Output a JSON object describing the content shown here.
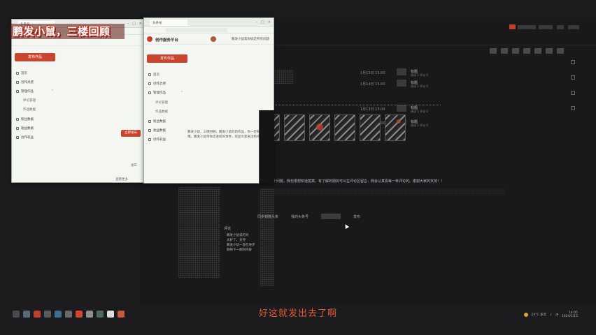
{
  "overlay": {
    "banner_text": "鹏发小鼠，三楼回顾"
  },
  "subtitle": "好这就发出去了啊",
  "background_app": {
    "top_items": [
      "",
      "",
      ""
    ],
    "table_rows": [
      {
        "date": "1月15日 15:00",
        "name": "标题",
        "meta": "阅读 1 评论 0"
      },
      {
        "date": "1月14日 15:00",
        "name": "标题",
        "meta": "阅读 1 评论 0"
      },
      {
        "date": "1月13日 15:00",
        "name": "标题",
        "meta": "阅读 1 评论 0"
      },
      {
        "date": "1月12日 15:00",
        "name": "标题",
        "meta": "阅读 1 评论 0"
      }
    ]
  },
  "window2": {
    "tab_label": "头条号",
    "site_title": "创作服务平台",
    "user_label": "鹏发小鼠帮你搞定所有问题",
    "publish_button": "发布作品",
    "menu": [
      {
        "label": "首页",
        "icon": "home-icon"
      },
      {
        "label": "创作灵感",
        "icon": "bulb-icon"
      },
      {
        "label": "管理作品",
        "icon": "folder-icon"
      },
      {
        "label": "评论管理",
        "icon": "comment-icon",
        "sub": true
      },
      {
        "label": "作品数据",
        "icon": "chart-icon",
        "sub": true
      },
      {
        "label": "粉丝数据",
        "icon": "users-icon"
      },
      {
        "label": "收益数据",
        "icon": "coin-icon"
      },
      {
        "label": "创作权益",
        "icon": "star-icon"
      }
    ],
    "article_text": "鹏发小鼠，三楼回顾，鹏发小鼠的新作品，你一定要去看看哦。鹏发小鼠带你走进新的世界，欢迎大家关注和评论。"
  },
  "window1": {
    "tab_label": "头条号",
    "publish_button": "发布作品",
    "menu": [
      {
        "label": "首页",
        "icon": "home-icon"
      },
      {
        "label": "创作灵感",
        "icon": "bulb-icon"
      },
      {
        "label": "管理作品",
        "icon": "folder-icon"
      },
      {
        "label": "评论管理",
        "icon": "comment-icon",
        "sub": true
      },
      {
        "label": "作品数据",
        "icon": "chart-icon",
        "sub": true
      },
      {
        "label": "粉丝数据",
        "icon": "users-icon"
      },
      {
        "label": "收益数据",
        "icon": "coin-icon"
      },
      {
        "label": "创作权益",
        "icon": "star-icon"
      }
    ],
    "side_button": "立即发布",
    "footer_text_1": "发布",
    "footer_text_2": "查看更多"
  },
  "dark_panel": {
    "long_line": "你说的这个问题，我也很想知道答案。有了解的朋友可以在评论区留言，我会认真看每一条评论的。谢谢大家的支持！！",
    "option_labels": [
      "同步到微头条",
      "我的头条号",
      "发布"
    ],
    "comments_title": "评论",
    "replies": [
      "鹏发小鼠说的对",
      "太好了，支持",
      "鹏发小鼠一直在进步",
      "期待下一期的内容"
    ]
  },
  "tray": {
    "weather": "24°C 多云",
    "time": "14:05",
    "date": "2024/1/15"
  },
  "colors": {
    "accent": "#c8462f",
    "banner_outline": "#c0392b",
    "subtitle": "#e55a36"
  }
}
